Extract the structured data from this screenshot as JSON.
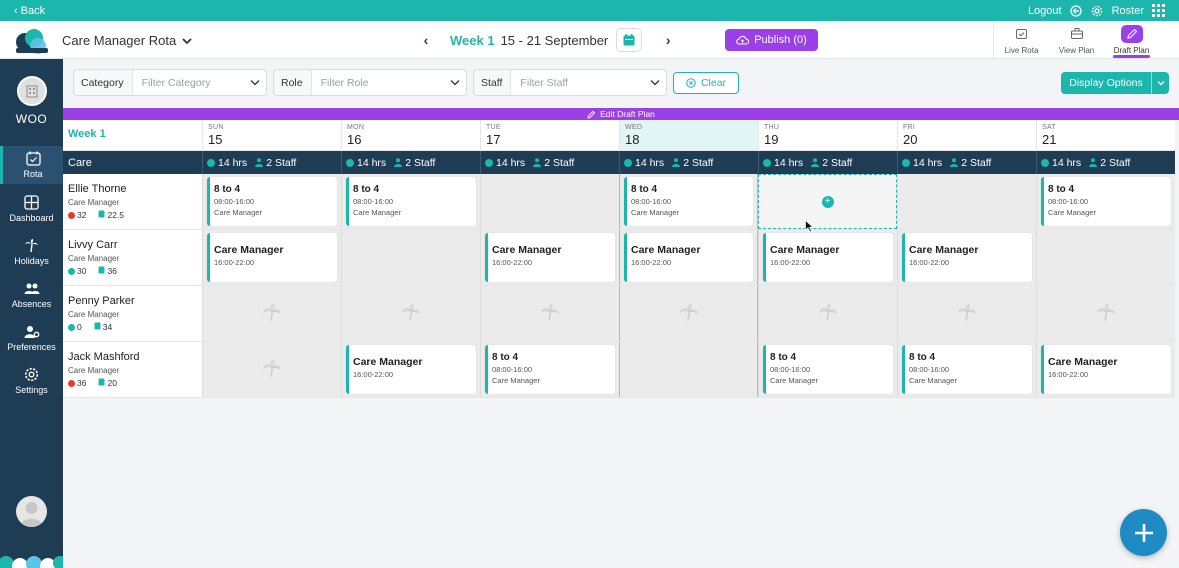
{
  "topbar": {
    "back_label": "Back",
    "logout_label": "Logout",
    "roster_label": "Roster"
  },
  "header": {
    "rota_title": "Care Manager Rota",
    "week_label": "Week 1",
    "week_dates": "15 - 21 September",
    "publish_label": "Publish (0)",
    "view_tabs": [
      {
        "label": "Live Rota",
        "icon": "calendar-check-icon"
      },
      {
        "label": "View Plan",
        "icon": "briefcase-icon"
      },
      {
        "label": "Draft Plan",
        "icon": "pencil-icon",
        "active": true
      }
    ]
  },
  "sidebar": {
    "org_name": "WOO",
    "items": [
      {
        "label": "Rota",
        "icon": "calendar-icon",
        "active": true
      },
      {
        "label": "Dashboard",
        "icon": "dashboard-icon"
      },
      {
        "label": "Holidays",
        "icon": "palm-tree-icon"
      },
      {
        "label": "Absences",
        "icon": "people-icon"
      },
      {
        "label": "Preferences",
        "icon": "user-gear-icon"
      },
      {
        "label": "Settings",
        "icon": "gear-icon"
      }
    ]
  },
  "filters": {
    "category": {
      "label": "Category",
      "placeholder": "Filter Category"
    },
    "role": {
      "label": "Role",
      "placeholder": "Filter Role"
    },
    "staff": {
      "label": "Staff",
      "placeholder": "Filter Staff"
    },
    "clear_label": "Clear",
    "display_options_label": "Display Options"
  },
  "draft_banner": "Edit Draft Plan",
  "grid": {
    "week_label": "Week 1",
    "days": [
      {
        "dow": "SUN",
        "date": "15"
      },
      {
        "dow": "MON",
        "date": "16"
      },
      {
        "dow": "TUE",
        "date": "17"
      },
      {
        "dow": "WED",
        "date": "18",
        "today": true
      },
      {
        "dow": "THU",
        "date": "19"
      },
      {
        "dow": "FRI",
        "date": "20"
      },
      {
        "dow": "SAT",
        "date": "21"
      }
    ],
    "group_label": "Care",
    "summary": {
      "hours": "14 hrs",
      "staff": "2 Staff"
    },
    "employees": [
      {
        "name": "Ellie Thorne",
        "role": "Care Manager",
        "stat1": "32",
        "stat1_color": "#e53935",
        "stat2": "22.5",
        "shifts": [
          {
            "name": "8 to 4",
            "time": "08:00-16:00",
            "role": "Care Manager"
          },
          {
            "name": "8 to 4",
            "time": "08:00-16:00",
            "role": "Care Manager"
          },
          null,
          {
            "name": "8 to 4",
            "time": "08:00-16:00",
            "role": "Care Manager"
          },
          "add",
          null,
          {
            "name": "8 to 4",
            "time": "08:00-16:00",
            "role": "Care Manager"
          }
        ]
      },
      {
        "name": "Livvy Carr",
        "role": "Care Manager",
        "stat1": "30",
        "stat1_color": "#1db6ad",
        "stat2": "36",
        "shifts": [
          {
            "name": "Care Manager",
            "time": "16:00-22:00",
            "big": true
          },
          null,
          {
            "name": "Care Manager",
            "time": "16:00-22:00",
            "big": true
          },
          {
            "name": "Care Manager",
            "time": "16:00-22:00",
            "big": true
          },
          {
            "name": "Care Manager",
            "time": "16:00-22:00",
            "big": true
          },
          {
            "name": "Care Manager",
            "time": "16:00-22:00",
            "big": true
          },
          null
        ]
      },
      {
        "name": "Penny Parker",
        "role": "Care Manager",
        "stat1": "0",
        "stat1_color": "#1db6ad",
        "stat2": "34",
        "shifts": [
          "holiday",
          "holiday",
          "holiday",
          "holiday",
          "holiday",
          "holiday",
          "holiday"
        ]
      },
      {
        "name": "Jack Mashford",
        "role": "Care Manager",
        "stat1": "36",
        "stat1_color": "#e53935",
        "stat2": "20",
        "shifts": [
          "holiday",
          {
            "name": "Care Manager",
            "time": "16:00-22:00",
            "big": true
          },
          {
            "name": "8 to 4",
            "time": "08:00-16:00",
            "role": "Care Manager"
          },
          null,
          {
            "name": "8 to 4",
            "time": "08:00-16:00",
            "role": "Care Manager"
          },
          {
            "name": "8 to 4",
            "time": "08:00-16:00",
            "role": "Care Manager"
          },
          {
            "name": "Care Manager",
            "time": "16:00-22:00",
            "big": true
          }
        ]
      }
    ]
  },
  "colors": {
    "teal": "#1db6ad",
    "navy": "#1f3c55",
    "purple": "#9b3fe6",
    "fab_blue": "#1f8bc4"
  }
}
